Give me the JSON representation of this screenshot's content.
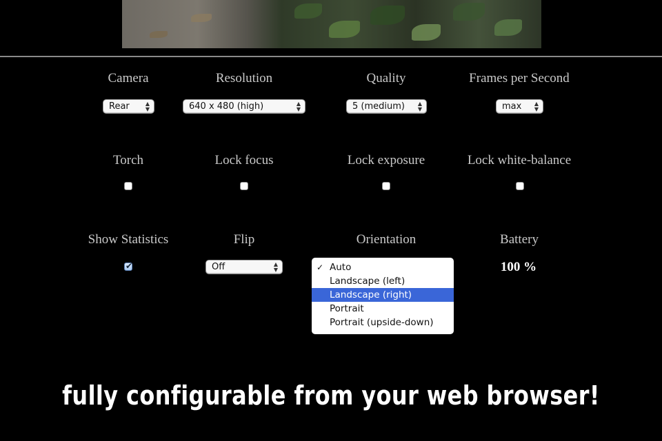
{
  "settings": {
    "camera": {
      "label": "Camera",
      "value": "Rear"
    },
    "resolution": {
      "label": "Resolution",
      "value": "640 x 480 (high)"
    },
    "quality": {
      "label": "Quality",
      "value": "5 (medium)"
    },
    "fps": {
      "label": "Frames per Second",
      "value": "max"
    },
    "torch": {
      "label": "Torch",
      "checked": false
    },
    "lock_focus": {
      "label": "Lock focus",
      "checked": false
    },
    "lock_exposure": {
      "label": "Lock exposure",
      "checked": false
    },
    "lock_wb": {
      "label": "Lock white-balance",
      "checked": false
    },
    "show_stats": {
      "label": "Show Statistics",
      "checked": true
    },
    "flip": {
      "label": "Flip",
      "value": "Off"
    },
    "orientation": {
      "label": "Orientation",
      "selected": "Auto",
      "highlighted": "Landscape (right)",
      "options": [
        "Auto",
        "Landscape (left)",
        "Landscape (right)",
        "Portrait",
        "Portrait (upside-down)"
      ]
    },
    "battery": {
      "label": "Battery",
      "value": "100 %"
    }
  },
  "caption": "fully configurable from your web browser!",
  "colors": {
    "background": "#000000",
    "label": "#c9c9c9",
    "highlight": "#3a66d8"
  }
}
